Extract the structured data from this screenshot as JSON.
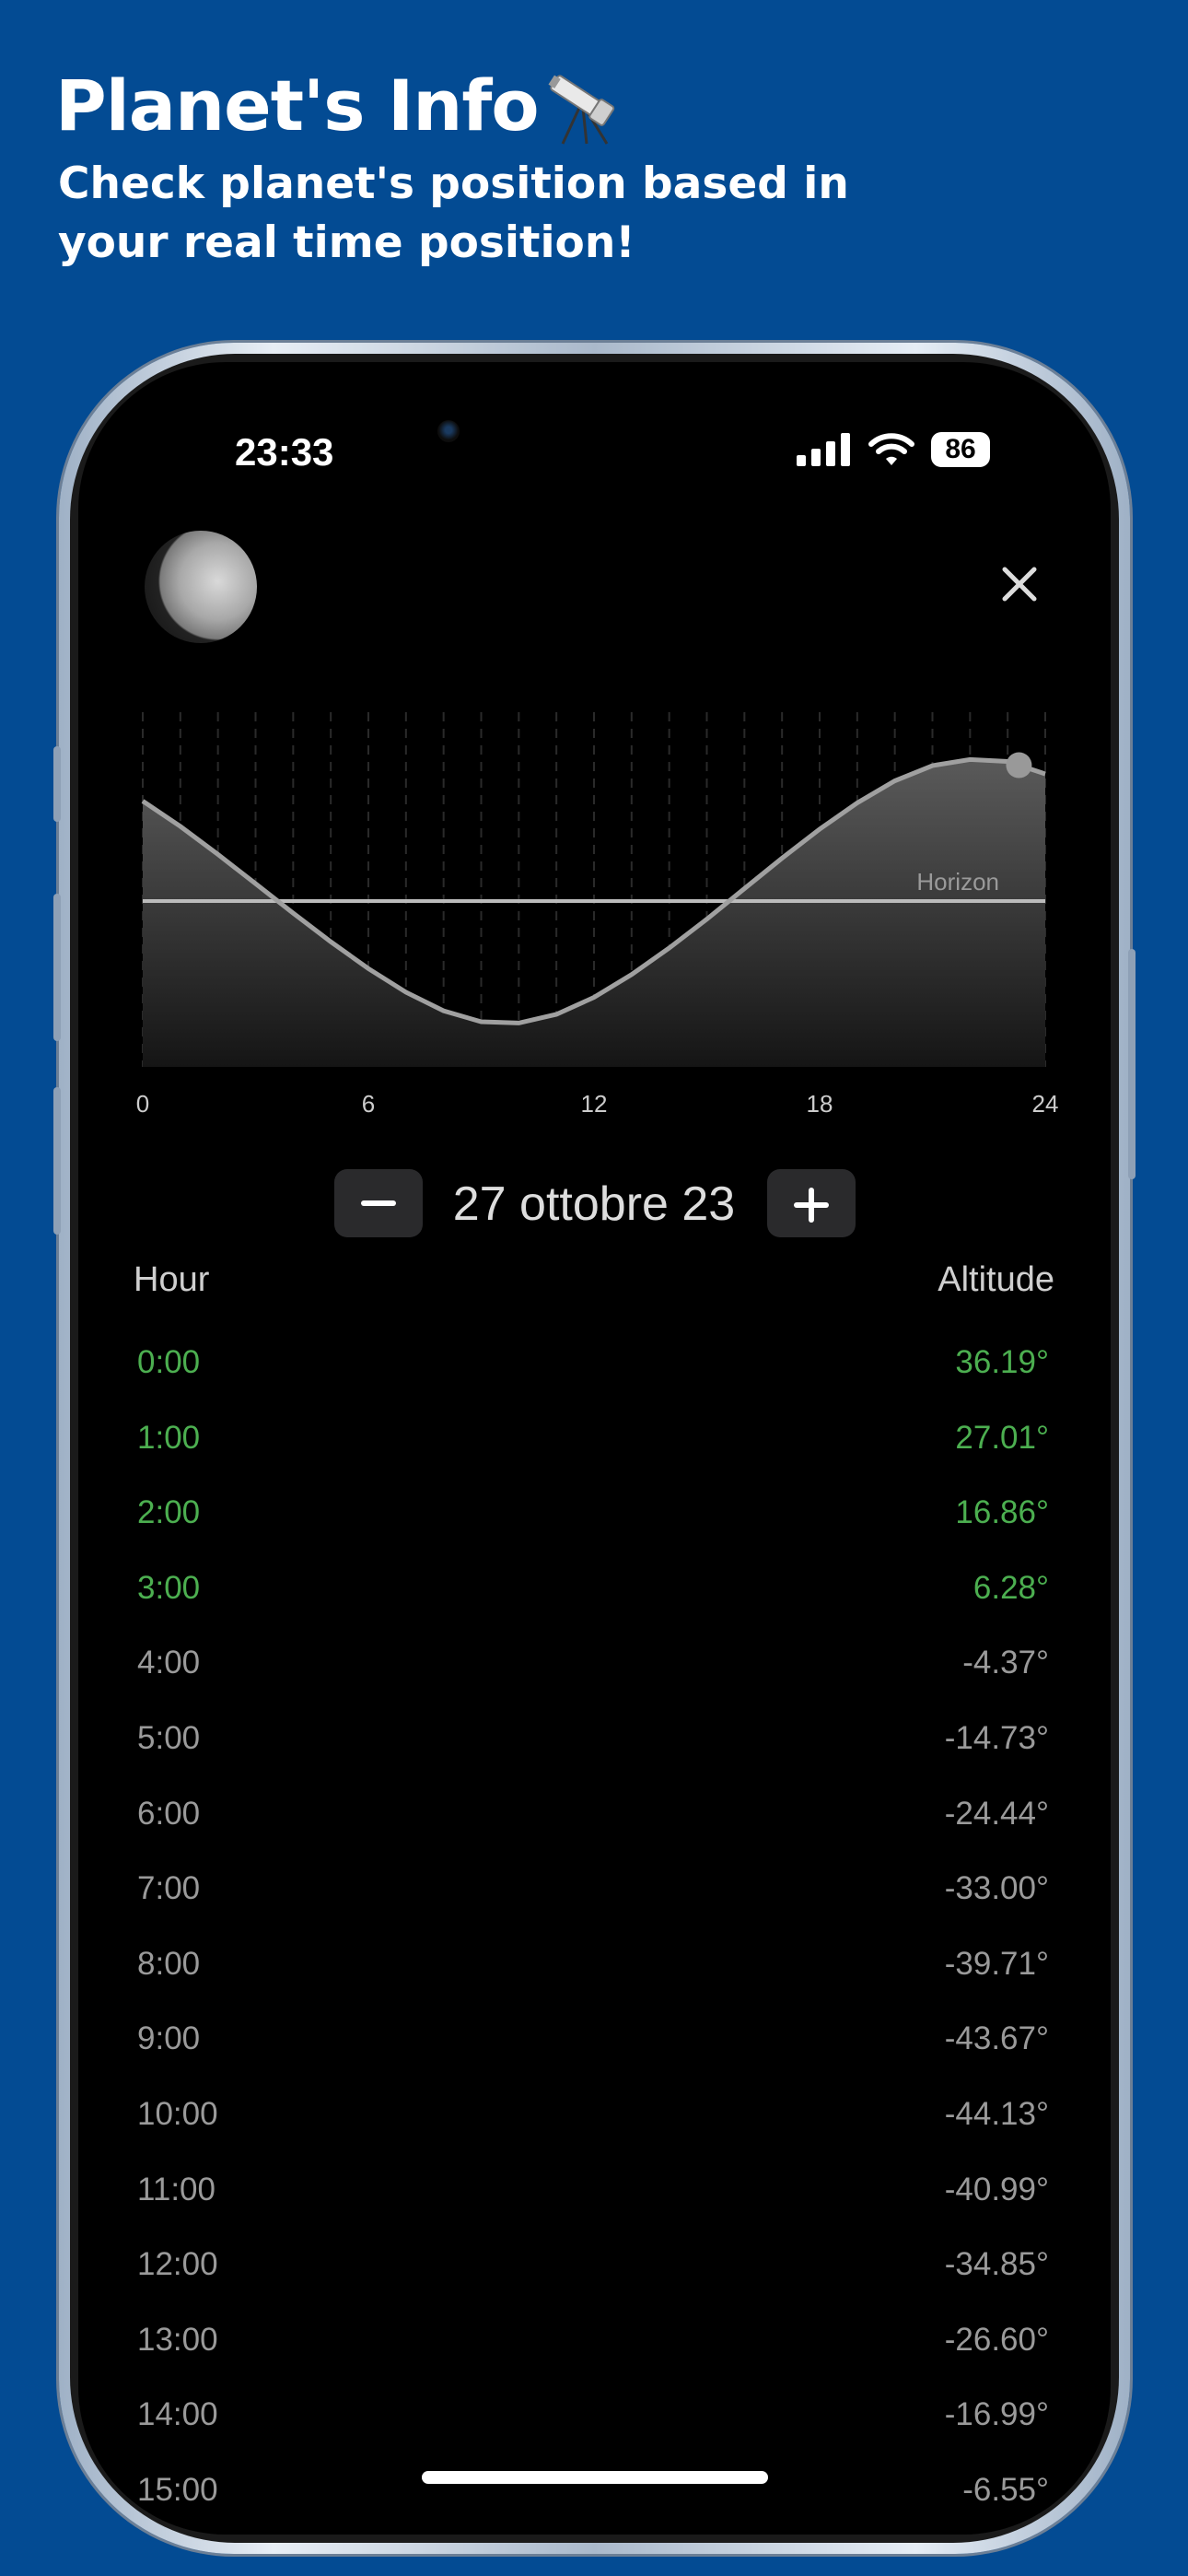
{
  "promo": {
    "title": "Planet's Info",
    "subtitle": "Check planet's position based in your real time position!"
  },
  "status_bar": {
    "time": "23:33",
    "battery": "86"
  },
  "chart_data": {
    "type": "area",
    "x": [
      0,
      1,
      2,
      3,
      4,
      5,
      6,
      7,
      8,
      9,
      10,
      11,
      12,
      13,
      14,
      15,
      16,
      17,
      18,
      19,
      20,
      21,
      22,
      23,
      24
    ],
    "y": [
      36.19,
      27.01,
      16.86,
      6.28,
      -4.37,
      -14.73,
      -24.44,
      -33.0,
      -39.71,
      -43.67,
      -44.13,
      -40.99,
      -34.85,
      -26.6,
      -16.99,
      -6.55,
      4.5,
      15.5,
      26.0,
      35.5,
      43.5,
      49.0,
      51.2,
      50.5,
      46.0
    ],
    "x_ticks": [
      "0",
      "6",
      "12",
      "18",
      "24"
    ],
    "horizon_label": "Horizon",
    "xlim": [
      0,
      24
    ],
    "ylim": [
      -60,
      65
    ],
    "current_hour": 23.3,
    "grid": "vertical dashed"
  },
  "date": {
    "label": "27 ottobre 23",
    "minus": "−",
    "plus": "+"
  },
  "table": {
    "col_hour": "Hour",
    "col_altitude": "Altitude",
    "rows": [
      {
        "hour": "0:00",
        "alt": "36.19°",
        "up": true
      },
      {
        "hour": "1:00",
        "alt": "27.01°",
        "up": true
      },
      {
        "hour": "2:00",
        "alt": "16.86°",
        "up": true
      },
      {
        "hour": "3:00",
        "alt": "6.28°",
        "up": true
      },
      {
        "hour": "4:00",
        "alt": "-4.37°",
        "up": false
      },
      {
        "hour": "5:00",
        "alt": "-14.73°",
        "up": false
      },
      {
        "hour": "6:00",
        "alt": "-24.44°",
        "up": false
      },
      {
        "hour": "7:00",
        "alt": "-33.00°",
        "up": false
      },
      {
        "hour": "8:00",
        "alt": "-39.71°",
        "up": false
      },
      {
        "hour": "9:00",
        "alt": "-43.67°",
        "up": false
      },
      {
        "hour": "10:00",
        "alt": "-44.13°",
        "up": false
      },
      {
        "hour": "11:00",
        "alt": "-40.99°",
        "up": false
      },
      {
        "hour": "12:00",
        "alt": "-34.85°",
        "up": false
      },
      {
        "hour": "13:00",
        "alt": "-26.60°",
        "up": false
      },
      {
        "hour": "14:00",
        "alt": "-16.99°",
        "up": false
      },
      {
        "hour": "15:00",
        "alt": "-6.55°",
        "up": false
      }
    ]
  },
  "colors": {
    "background": "#034b93",
    "visible": "#4caf50",
    "below": "#9a9a9a"
  }
}
